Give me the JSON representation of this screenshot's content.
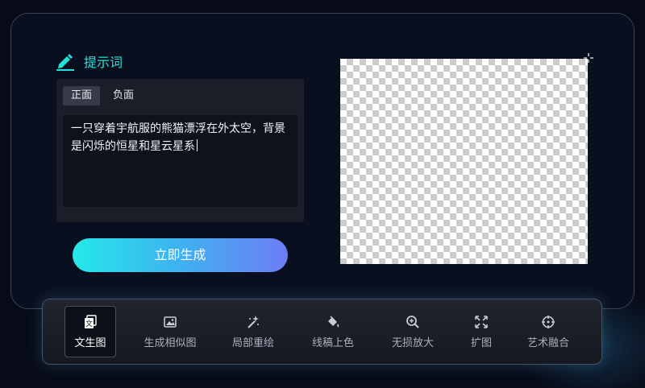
{
  "prompt": {
    "title": "提示词",
    "tabs": [
      {
        "label": "正面",
        "active": true
      },
      {
        "label": "负面",
        "active": false
      }
    ],
    "text": "一只穿着宇航服的熊猫漂浮在外太空，背景是闪烁的恒星和星云星系"
  },
  "generate_button": "立即生成",
  "toolbar": {
    "items": [
      {
        "label": "文生图",
        "icon": "text-to-image-icon",
        "active": true
      },
      {
        "label": "生成相似图",
        "icon": "image-icon",
        "active": false
      },
      {
        "label": "局部重绘",
        "icon": "magic-wand-icon",
        "active": false
      },
      {
        "label": "线稿上色",
        "icon": "paint-bucket-icon",
        "active": false
      },
      {
        "label": "无损放大",
        "icon": "zoom-in-icon",
        "active": false
      },
      {
        "label": "扩图",
        "icon": "expand-icon",
        "active": false
      },
      {
        "label": "艺术融合",
        "icon": "crosshair-target-icon",
        "active": false
      }
    ]
  },
  "colors": {
    "accent": "#1ee3d6",
    "button_gradient_start": "#24e9ea",
    "button_gradient_end": "#6c7df5",
    "background": "#070b18"
  }
}
